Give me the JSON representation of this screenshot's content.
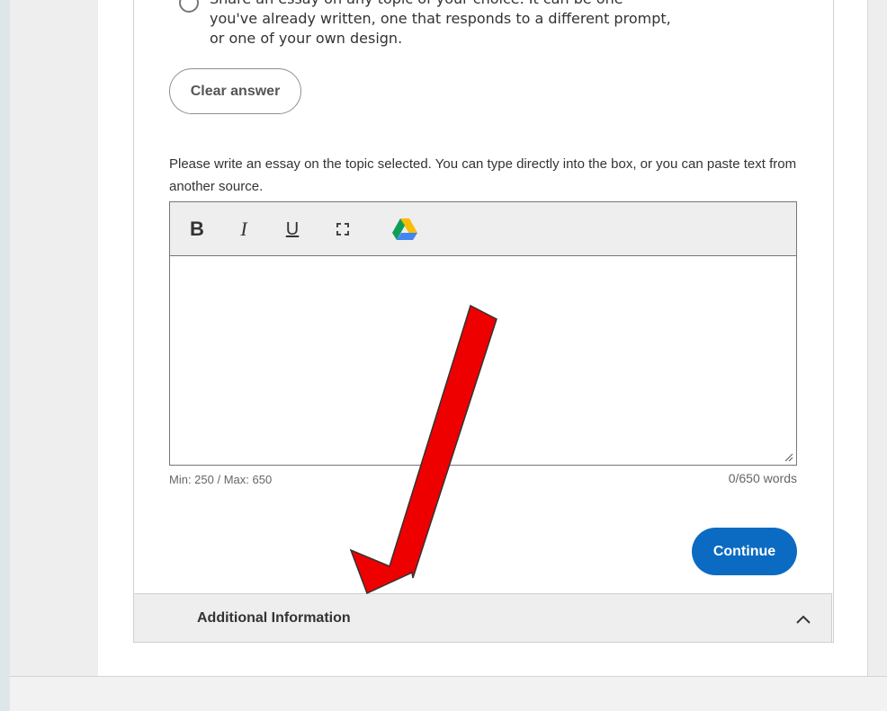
{
  "essay_option": {
    "lines": [
      "Share an essay on any topic of your choice. It can be one",
      "you've already written, one that responds to a different prompt,",
      "or one of your own design."
    ]
  },
  "buttons": {
    "clear_answer": "Clear answer",
    "continue": "Continue"
  },
  "instructions": "Please write an essay on the topic selected. You can type directly into the box, or you can paste text from another source.",
  "editor": {
    "toolbar": {
      "bold": "B",
      "italic": "I",
      "underline": "U",
      "icons": [
        "expand-icon",
        "google-drive-icon"
      ]
    },
    "limits": "Min: 250 / Max: 650",
    "word_count": "0/650 words"
  },
  "additional_information": {
    "title": "Additional Information",
    "icon": "chevron-up-icon"
  },
  "colors": {
    "primary_button": "#0b6bc2",
    "annotation_arrow": "#ee0000"
  }
}
